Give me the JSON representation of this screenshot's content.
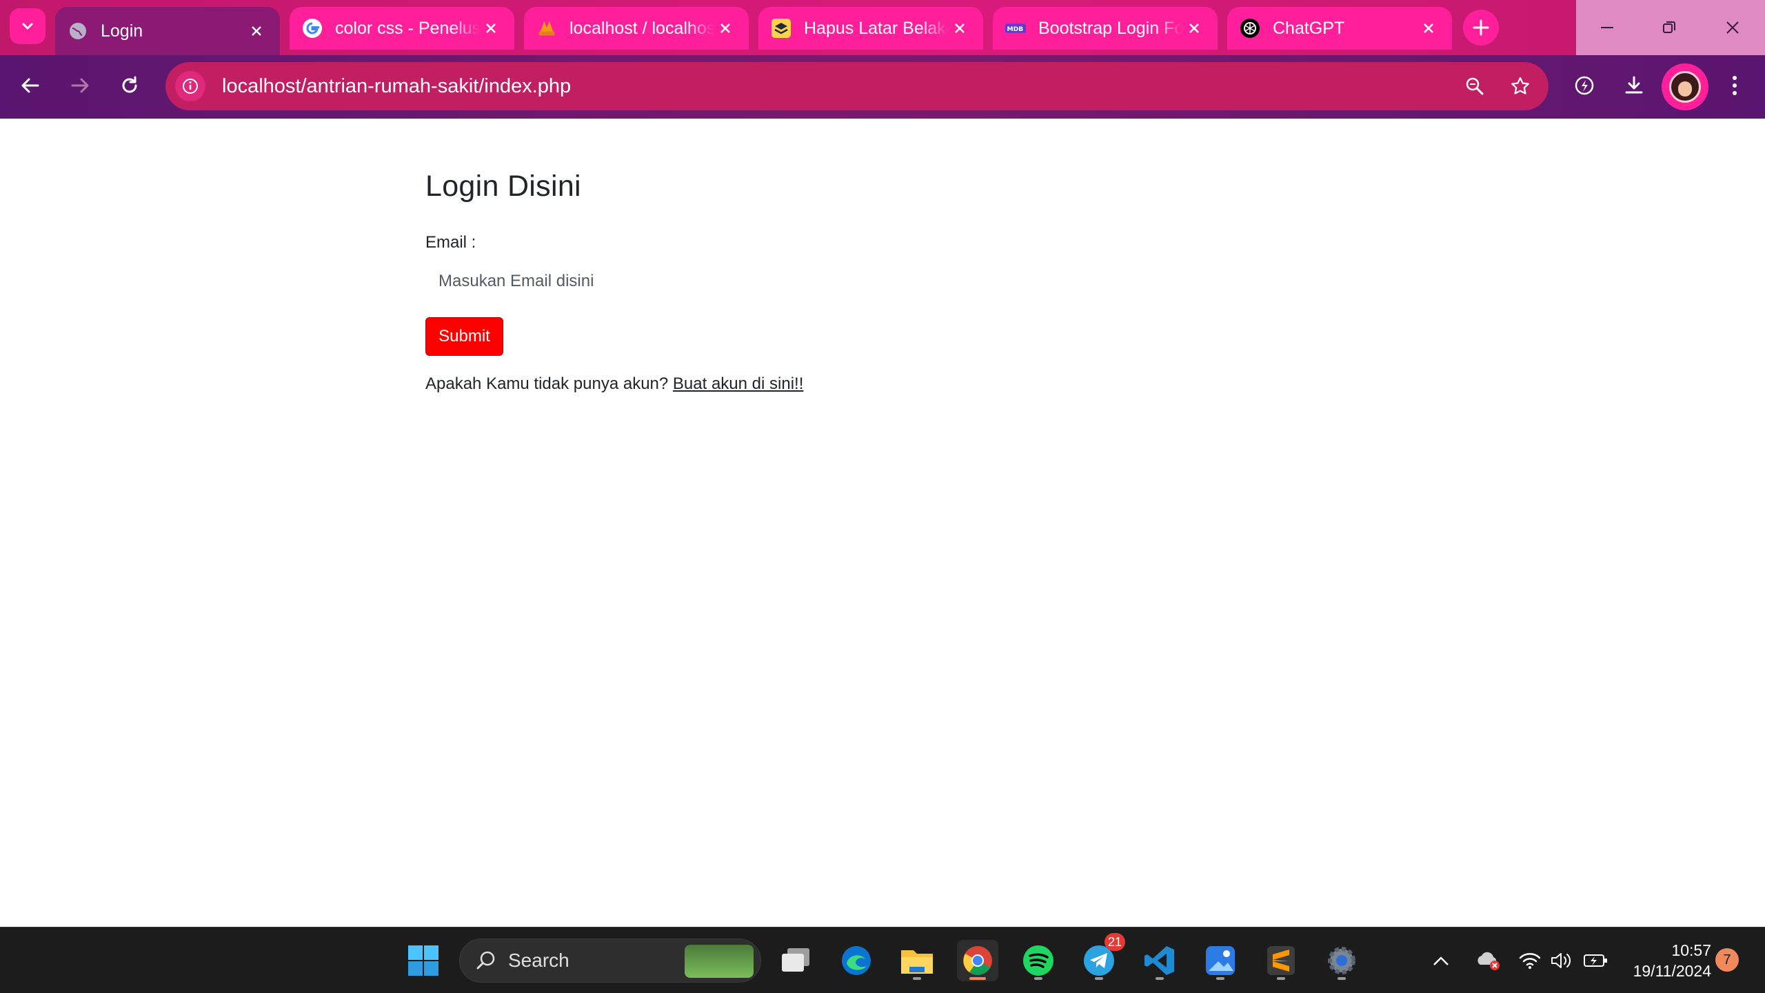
{
  "browser": {
    "tabs": [
      {
        "title": "Login",
        "favicon": "globe-icon",
        "active": true
      },
      {
        "title": "color css - Penelusuran Google",
        "favicon": "google-icon",
        "active": false
      },
      {
        "title": "localhost / localhost / db_antrian",
        "favicon": "phpmyadmin-icon",
        "active": false
      },
      {
        "title": "Hapus Latar Belakang",
        "favicon": "layers-icon",
        "active": false
      },
      {
        "title": "Bootstrap Login Form",
        "favicon": "mdb-icon",
        "active": false
      },
      {
        "title": "ChatGPT",
        "favicon": "openai-icon",
        "active": false
      }
    ],
    "url": "localhost/antrian-rumah-sakit/index.php",
    "colors": {
      "tabbar": "#d81b7a",
      "active_tab": "#8a1a74",
      "toolbar": "#6b1870",
      "omnibox": "#c21f63"
    }
  },
  "page": {
    "heading": "Login Disini",
    "email_label": "Email :",
    "email_placeholder": "Masukan Email disini",
    "email_value": "",
    "submit_label": "Submit",
    "register_prompt": "Apakah Kamu tidak punya akun? ",
    "register_link": "Buat akun di sini!!",
    "submit_color": "#ff0000"
  },
  "taskbar": {
    "search_label": "Search",
    "telegram_badge": "21",
    "time": "10:57",
    "date": "19/11/2024",
    "notification_count": "7"
  }
}
